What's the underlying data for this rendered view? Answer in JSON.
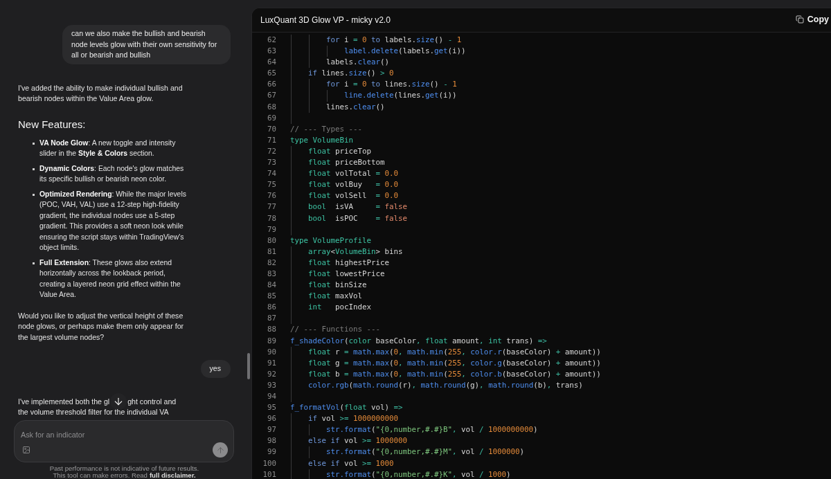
{
  "chat": {
    "messages": [
      {
        "kind": "user",
        "text": "can we also make the bullish and bearish node levels glow with their own sensitivity for all or bearish and bullish"
      },
      {
        "kind": "assistant",
        "blocks": [
          {
            "kind": "paragraph",
            "text": "I've added the ability to make individual bullish and bearish nodes within the Value Area glow."
          },
          {
            "kind": "heading",
            "text": "New Features:"
          },
          {
            "kind": "list",
            "items": [
              "**VA Node Glow**: A new toggle and intensity slider in the **Style & Colors** section.",
              "**Dynamic Colors**: Each node's glow matches its specific bullish or bearish neon color.",
              "**Optimized Rendering**: While the major levels (POC, VAH, VAL) use a 12-step high-fidelity gradient, the individual nodes use a 5-step gradient. This provides a soft neon look while ensuring the script stays within TradingView's object limits.",
              "**Full Extension**: These glows also extend horizontally across the lookback period, creating a layered neon grid effect within the Value Area."
            ]
          },
          {
            "kind": "paragraph",
            "text": "Would you like to adjust the vertical height of these node glows, or perhaps make them only appear for the largest volume nodes?"
          }
        ]
      },
      {
        "kind": "user",
        "text": "yes"
      },
      {
        "kind": "assistant",
        "blocks": [
          {
            "kind": "covered_paragraph",
            "visible_start": "I've implemented both the gl",
            "visible_end": "ght control and",
            "next_line": "the volume threshold filter for the individual VA"
          }
        ]
      }
    ]
  },
  "composer": {
    "placeholder": "Ask for an indicator"
  },
  "disclaimer": {
    "text": "Past performance is not indicative of future results.",
    "line_2": "This tool can make errors. Read",
    "link": "full disclaimer."
  },
  "code_panel": {
    "title": "LuxQuant 3D Glow VP - micky v2.0",
    "copy_label": "Copy",
    "lines": [
      {
        "number": "62",
        "tokens": [
          {
            "text": "        for",
            "kind": "keyword"
          },
          {
            "text": " i ",
            "kind": "plain"
          },
          {
            "text": "= ",
            "kind": "operator"
          },
          {
            "text": "0 ",
            "kind": "number"
          },
          {
            "text": "to",
            "kind": "keyword"
          },
          {
            "text": " labels.",
            "kind": "plain"
          },
          {
            "text": "size",
            "kind": "function"
          },
          {
            "text": "() ",
            "kind": "plain"
          },
          {
            "text": "- ",
            "kind": "operator"
          },
          {
            "text": "1",
            "kind": "number"
          }
        ]
      },
      {
        "number": "63",
        "tokens": [
          {
            "text": "            label.delete",
            "kind": "function"
          },
          {
            "text": "(labels.",
            "kind": "plain"
          },
          {
            "text": "get",
            "kind": "function"
          },
          {
            "text": "(i))",
            "kind": "plain"
          }
        ]
      },
      {
        "number": "64",
        "tokens": [
          {
            "text": "        labels.",
            "kind": "plain"
          },
          {
            "text": "clear",
            "kind": "function"
          },
          {
            "text": "()",
            "kind": "plain"
          }
        ]
      },
      {
        "number": "65",
        "tokens": [
          {
            "text": "    if",
            "kind": "keyword"
          },
          {
            "text": " lines.",
            "kind": "plain"
          },
          {
            "text": "size",
            "kind": "function"
          },
          {
            "text": "() ",
            "kind": "plain"
          },
          {
            "text": "> ",
            "kind": "operator"
          },
          {
            "text": "0",
            "kind": "number"
          }
        ]
      },
      {
        "number": "66",
        "tokens": [
          {
            "text": "        for",
            "kind": "keyword"
          },
          {
            "text": " i ",
            "kind": "plain"
          },
          {
            "text": "= ",
            "kind": "operator"
          },
          {
            "text": "0 ",
            "kind": "number"
          },
          {
            "text": "to",
            "kind": "keyword"
          },
          {
            "text": " lines.",
            "kind": "plain"
          },
          {
            "text": "size",
            "kind": "function"
          },
          {
            "text": "() ",
            "kind": "plain"
          },
          {
            "text": "- ",
            "kind": "operator"
          },
          {
            "text": "1",
            "kind": "number"
          }
        ]
      },
      {
        "number": "67",
        "tokens": [
          {
            "text": "            line.delete",
            "kind": "function"
          },
          {
            "text": "(lines.",
            "kind": "plain"
          },
          {
            "text": "get",
            "kind": "function"
          },
          {
            "text": "(i))",
            "kind": "plain"
          }
        ]
      },
      {
        "number": "68",
        "tokens": [
          {
            "text": "        lines.",
            "kind": "plain"
          },
          {
            "text": "clear",
            "kind": "function"
          },
          {
            "text": "()",
            "kind": "plain"
          }
        ]
      },
      {
        "number": "69"
      },
      {
        "number": "70",
        "tokens": [
          {
            "text": "// --- Types ---",
            "kind": "comment"
          }
        ]
      },
      {
        "number": "71",
        "tokens": [
          {
            "text": "type VolumeBin",
            "kind": "type"
          }
        ]
      },
      {
        "number": "72",
        "tokens": [
          {
            "text": "    float",
            "kind": "type"
          },
          {
            "text": " priceTop",
            "kind": "plain"
          }
        ]
      },
      {
        "number": "73",
        "tokens": [
          {
            "text": "    float",
            "kind": "type"
          },
          {
            "text": " priceBottom",
            "kind": "plain"
          }
        ]
      },
      {
        "number": "74",
        "tokens": [
          {
            "text": "    float",
            "kind": "type"
          },
          {
            "text": " volTotal ",
            "kind": "plain"
          },
          {
            "text": "= ",
            "kind": "operator"
          },
          {
            "text": "0.0",
            "kind": "number"
          }
        ]
      },
      {
        "number": "75",
        "tokens": [
          {
            "text": "    float",
            "kind": "type"
          },
          {
            "text": " volBuy   ",
            "kind": "plain"
          },
          {
            "text": "= ",
            "kind": "operator"
          },
          {
            "text": "0.0",
            "kind": "number"
          }
        ]
      },
      {
        "number": "76",
        "tokens": [
          {
            "text": "    float",
            "kind": "type"
          },
          {
            "text": " volSell  ",
            "kind": "plain"
          },
          {
            "text": "= ",
            "kind": "operator"
          },
          {
            "text": "0.0",
            "kind": "number"
          }
        ]
      },
      {
        "number": "77",
        "tokens": [
          {
            "text": "    bool",
            "kind": "type"
          },
          {
            "text": "  isVA     ",
            "kind": "plain"
          },
          {
            "text": "= ",
            "kind": "operator"
          },
          {
            "text": "false",
            "kind": "boolean"
          }
        ]
      },
      {
        "number": "78",
        "tokens": [
          {
            "text": "    bool",
            "kind": "type"
          },
          {
            "text": "  isPOC    ",
            "kind": "plain"
          },
          {
            "text": "= ",
            "kind": "operator"
          },
          {
            "text": "false",
            "kind": "boolean"
          }
        ]
      },
      {
        "number": "79"
      },
      {
        "number": "80",
        "tokens": [
          {
            "text": "type VolumeProfile",
            "kind": "type"
          }
        ]
      },
      {
        "number": "81",
        "tokens": [
          {
            "text": "    array",
            "kind": "type"
          },
          {
            "text": "<",
            "kind": "plain"
          },
          {
            "text": "VolumeBin",
            "kind": "type"
          },
          {
            "text": "> bins",
            "kind": "plain"
          }
        ]
      },
      {
        "number": "82",
        "tokens": [
          {
            "text": "    float",
            "kind": "type"
          },
          {
            "text": " highestPrice",
            "kind": "plain"
          }
        ]
      },
      {
        "number": "83",
        "tokens": [
          {
            "text": "    float",
            "kind": "type"
          },
          {
            "text": " lowestPrice",
            "kind": "plain"
          }
        ]
      },
      {
        "number": "84",
        "tokens": [
          {
            "text": "    float",
            "kind": "type"
          },
          {
            "text": " binSize",
            "kind": "plain"
          }
        ]
      },
      {
        "number": "85",
        "tokens": [
          {
            "text": "    float",
            "kind": "type"
          },
          {
            "text": " maxVol",
            "kind": "plain"
          }
        ]
      },
      {
        "number": "86",
        "tokens": [
          {
            "text": "    int",
            "kind": "type"
          },
          {
            "text": "   pocIndex",
            "kind": "plain"
          }
        ]
      },
      {
        "number": "87"
      },
      {
        "number": "88",
        "tokens": [
          {
            "text": "// --- Functions ---",
            "kind": "comment"
          }
        ]
      },
      {
        "number": "89",
        "tokens": [
          {
            "text": "f_shadeColor",
            "kind": "function"
          },
          {
            "text": "(",
            "kind": "plain"
          },
          {
            "text": "color",
            "kind": "type"
          },
          {
            "text": " baseColor",
            "kind": "plain"
          },
          {
            "text": ", ",
            "kind": "operator"
          },
          {
            "text": "float",
            "kind": "type"
          },
          {
            "text": " amount",
            "kind": "plain"
          },
          {
            "text": ", ",
            "kind": "operator"
          },
          {
            "text": "int",
            "kind": "type"
          },
          {
            "text": " trans) ",
            "kind": "plain"
          },
          {
            "text": "=>",
            "kind": "operator"
          }
        ]
      },
      {
        "number": "90",
        "tokens": [
          {
            "text": "    float",
            "kind": "type"
          },
          {
            "text": " r ",
            "kind": "plain"
          },
          {
            "text": "= ",
            "kind": "operator"
          },
          {
            "text": "math.max",
            "kind": "function"
          },
          {
            "text": "(",
            "kind": "plain"
          },
          {
            "text": "0",
            "kind": "number"
          },
          {
            "text": ", ",
            "kind": "operator"
          },
          {
            "text": "math.min",
            "kind": "function"
          },
          {
            "text": "(",
            "kind": "plain"
          },
          {
            "text": "255",
            "kind": "number"
          },
          {
            "text": ", ",
            "kind": "operator"
          },
          {
            "text": "color.r",
            "kind": "function"
          },
          {
            "text": "(baseColor) ",
            "kind": "plain"
          },
          {
            "text": "+ ",
            "kind": "operator"
          },
          {
            "text": "amount))",
            "kind": "plain"
          }
        ]
      },
      {
        "number": "91",
        "tokens": [
          {
            "text": "    float",
            "kind": "type"
          },
          {
            "text": " g ",
            "kind": "plain"
          },
          {
            "text": "= ",
            "kind": "operator"
          },
          {
            "text": "math.max",
            "kind": "function"
          },
          {
            "text": "(",
            "kind": "plain"
          },
          {
            "text": "0",
            "kind": "number"
          },
          {
            "text": ", ",
            "kind": "operator"
          },
          {
            "text": "math.min",
            "kind": "function"
          },
          {
            "text": "(",
            "kind": "plain"
          },
          {
            "text": "255",
            "kind": "number"
          },
          {
            "text": ", ",
            "kind": "operator"
          },
          {
            "text": "color.g",
            "kind": "function"
          },
          {
            "text": "(baseColor) ",
            "kind": "plain"
          },
          {
            "text": "+ ",
            "kind": "operator"
          },
          {
            "text": "amount))",
            "kind": "plain"
          }
        ]
      },
      {
        "number": "92",
        "tokens": [
          {
            "text": "    float",
            "kind": "type"
          },
          {
            "text": " b ",
            "kind": "plain"
          },
          {
            "text": "= ",
            "kind": "operator"
          },
          {
            "text": "math.max",
            "kind": "function"
          },
          {
            "text": "(",
            "kind": "plain"
          },
          {
            "text": "0",
            "kind": "number"
          },
          {
            "text": ", ",
            "kind": "operator"
          },
          {
            "text": "math.min",
            "kind": "function"
          },
          {
            "text": "(",
            "kind": "plain"
          },
          {
            "text": "255",
            "kind": "number"
          },
          {
            "text": ", ",
            "kind": "operator"
          },
          {
            "text": "color.b",
            "kind": "function"
          },
          {
            "text": "(baseColor) ",
            "kind": "plain"
          },
          {
            "text": "+ ",
            "kind": "operator"
          },
          {
            "text": "amount))",
            "kind": "plain"
          }
        ]
      },
      {
        "number": "93",
        "tokens": [
          {
            "text": "    color.rgb",
            "kind": "function"
          },
          {
            "text": "(",
            "kind": "plain"
          },
          {
            "text": "math.round",
            "kind": "function"
          },
          {
            "text": "(r)",
            "kind": "plain"
          },
          {
            "text": ", ",
            "kind": "operator"
          },
          {
            "text": "math.round",
            "kind": "function"
          },
          {
            "text": "(g)",
            "kind": "plain"
          },
          {
            "text": ", ",
            "kind": "operator"
          },
          {
            "text": "math.round",
            "kind": "function"
          },
          {
            "text": "(b)",
            "kind": "plain"
          },
          {
            "text": ", ",
            "kind": "operator"
          },
          {
            "text": "trans)",
            "kind": "plain"
          }
        ]
      },
      {
        "number": "94"
      },
      {
        "number": "95",
        "tokens": [
          {
            "text": "f_formatVol",
            "kind": "function"
          },
          {
            "text": "(",
            "kind": "plain"
          },
          {
            "text": "float",
            "kind": "type"
          },
          {
            "text": " vol) ",
            "kind": "plain"
          },
          {
            "text": "=>",
            "kind": "operator"
          }
        ]
      },
      {
        "number": "96",
        "tokens": [
          {
            "text": "    if",
            "kind": "keyword"
          },
          {
            "text": " vol ",
            "kind": "plain"
          },
          {
            "text": ">= ",
            "kind": "operator"
          },
          {
            "text": "1000000000",
            "kind": "number"
          }
        ]
      },
      {
        "number": "97",
        "tokens": [
          {
            "text": "        str.format",
            "kind": "function"
          },
          {
            "text": "(",
            "kind": "plain"
          },
          {
            "text": "\"{0,number,#.#}B\"",
            "kind": "string"
          },
          {
            "text": ", ",
            "kind": "operator"
          },
          {
            "text": "vol ",
            "kind": "plain"
          },
          {
            "text": "/ ",
            "kind": "operator"
          },
          {
            "text": "1000000000",
            "kind": "number"
          },
          {
            "text": ")",
            "kind": "plain"
          }
        ]
      },
      {
        "number": "98",
        "tokens": [
          {
            "text": "    else if",
            "kind": "keyword"
          },
          {
            "text": " vol ",
            "kind": "plain"
          },
          {
            "text": ">= ",
            "kind": "operator"
          },
          {
            "text": "1000000",
            "kind": "number"
          }
        ]
      },
      {
        "number": "99",
        "tokens": [
          {
            "text": "        str.format",
            "kind": "function"
          },
          {
            "text": "(",
            "kind": "plain"
          },
          {
            "text": "\"{0,number,#.#}M\"",
            "kind": "string"
          },
          {
            "text": ", ",
            "kind": "operator"
          },
          {
            "text": "vol ",
            "kind": "plain"
          },
          {
            "text": "/ ",
            "kind": "operator"
          },
          {
            "text": "1000000",
            "kind": "number"
          },
          {
            "text": ")",
            "kind": "plain"
          }
        ]
      },
      {
        "number": "100",
        "tokens": [
          {
            "text": "    else if",
            "kind": "keyword"
          },
          {
            "text": " vol ",
            "kind": "plain"
          },
          {
            "text": ">= ",
            "kind": "operator"
          },
          {
            "text": "1000",
            "kind": "number"
          }
        ]
      },
      {
        "number": "101",
        "tokens": [
          {
            "text": "        str.format",
            "kind": "function"
          },
          {
            "text": "(",
            "kind": "plain"
          },
          {
            "text": "\"{0,number,#.#}K\"",
            "kind": "string"
          },
          {
            "text": ", ",
            "kind": "operator"
          },
          {
            "text": "vol ",
            "kind": "plain"
          },
          {
            "text": "/ ",
            "kind": "operator"
          },
          {
            "text": "1000",
            "kind": "number"
          },
          {
            "text": ")",
            "kind": "plain"
          }
        ]
      }
    ]
  }
}
